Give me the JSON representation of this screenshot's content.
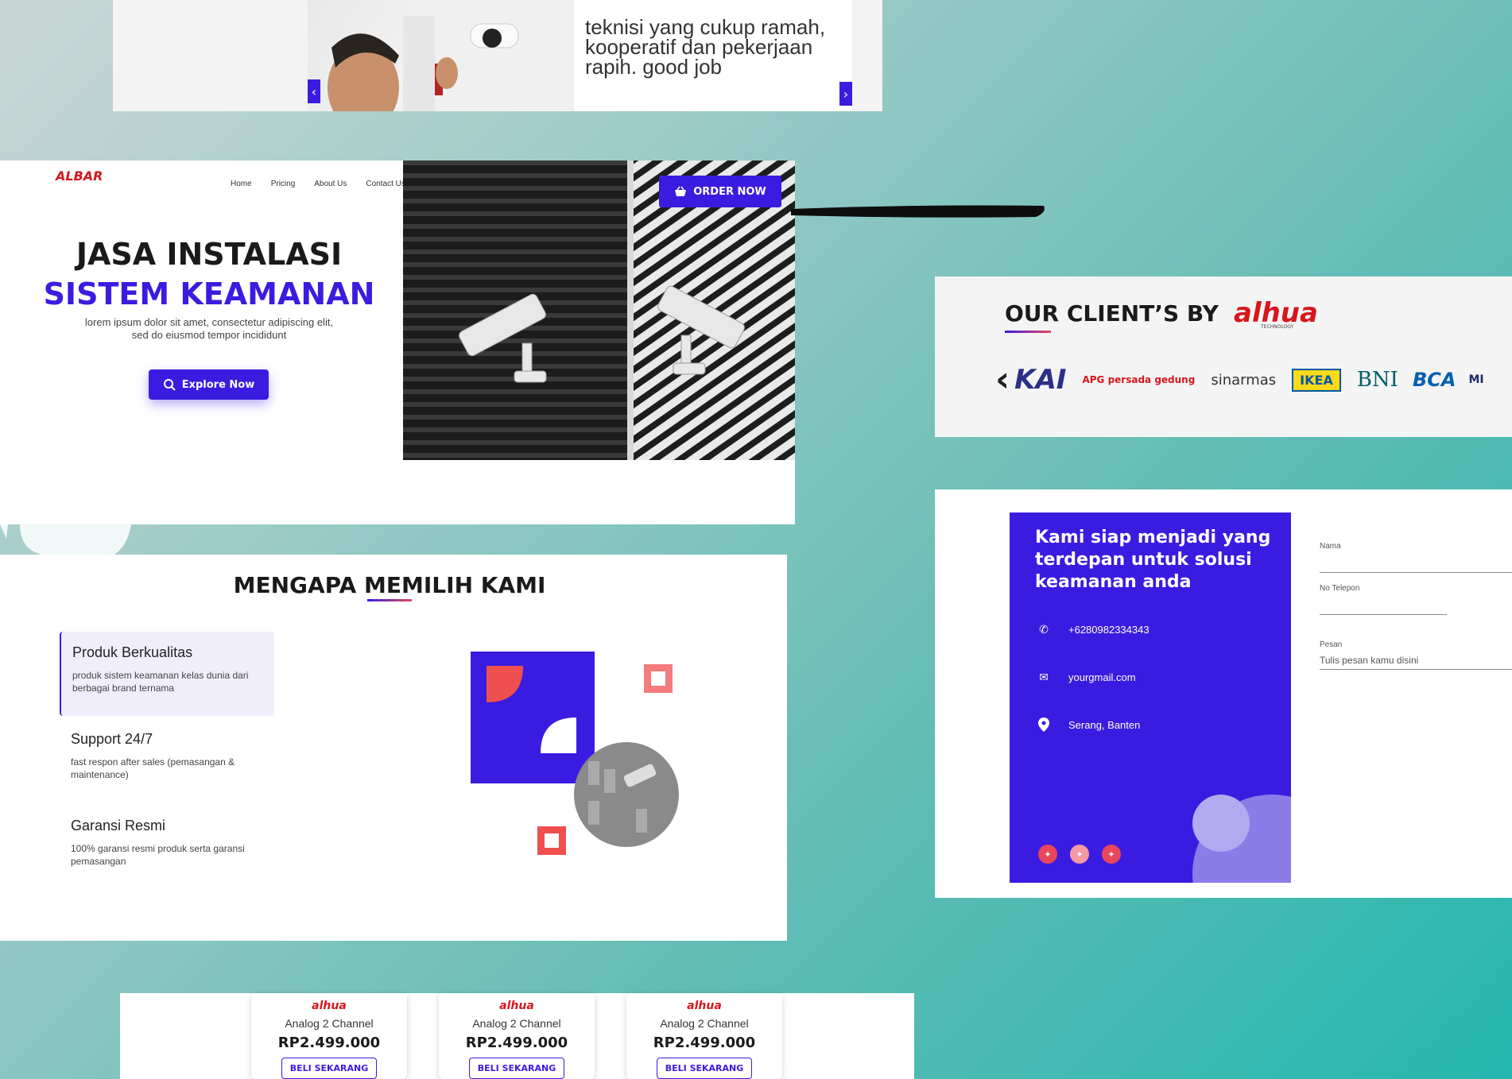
{
  "testimonial": {
    "quote": "teknisi yang cukup ramah, kooperatif dan pekerjaan rapih. good job",
    "prev_icon": "chevron-left-icon",
    "next_icon": "chevron-right-icon"
  },
  "hero": {
    "logo": "ALBAR",
    "nav": [
      "Home",
      "Pricing",
      "About Us",
      "Contact Us"
    ],
    "title_line1": "JASA INSTALASI",
    "title_line2": "SISTEM KEAMANAN",
    "subtitle": "lorem ipsum dolor sit amet, consectetur adipiscing elit, sed do eiusmod tempor incididunt",
    "explore_label": "Explore Now",
    "order_label": "ORDER NOW"
  },
  "clients": {
    "title": "OUR CLIENT’S BY",
    "brand": "alhua",
    "brand_sub": "TECHNOLOGY",
    "logos": [
      "KAI",
      "APG persada gedung",
      "sinarmas",
      "IKEA",
      "BNI",
      "BCA",
      "MI"
    ]
  },
  "why": {
    "title": "MENGAPA MEMILIH KAMI",
    "features": [
      {
        "title": "Produk Berkualitas",
        "desc": "produk sistem keamanan kelas dunia dari berbagai brand ternama"
      },
      {
        "title": "Support 24/7",
        "desc": "fast respon after sales (pemasangan & maintenance)"
      },
      {
        "title": "Garansi Resmi",
        "desc": "100% garansi resmi produk serta garansi pemasangan"
      }
    ]
  },
  "contact": {
    "heading": "Kami siap menjadi yang terdepan untuk solusi keamanan anda",
    "phone": "+6280982334343",
    "email": "yourgmail.com",
    "location": "Serang, Banten",
    "form": {
      "name_label": "Nama",
      "phone_label": "No Telepon",
      "message_label": "Pesan",
      "message_placeholder": "Tulis pesan kamu disini"
    }
  },
  "pricing": {
    "cards": [
      {
        "brand": "alhua",
        "name": "Analog 2 Channel",
        "price": "RP2.499.000",
        "cta": "BELI SEKARANG"
      },
      {
        "brand": "alhua",
        "name": "Analog 2 Channel",
        "price": "RP2.499.000",
        "cta": "BELI SEKARANG"
      },
      {
        "brand": "alhua",
        "name": "Analog 2 Channel",
        "price": "RP2.499.000",
        "cta": "BELI SEKARANG"
      }
    ]
  },
  "colors": {
    "accent": "#3a1ce0",
    "brand_red": "#d6171e",
    "coral": "#e8475b"
  }
}
